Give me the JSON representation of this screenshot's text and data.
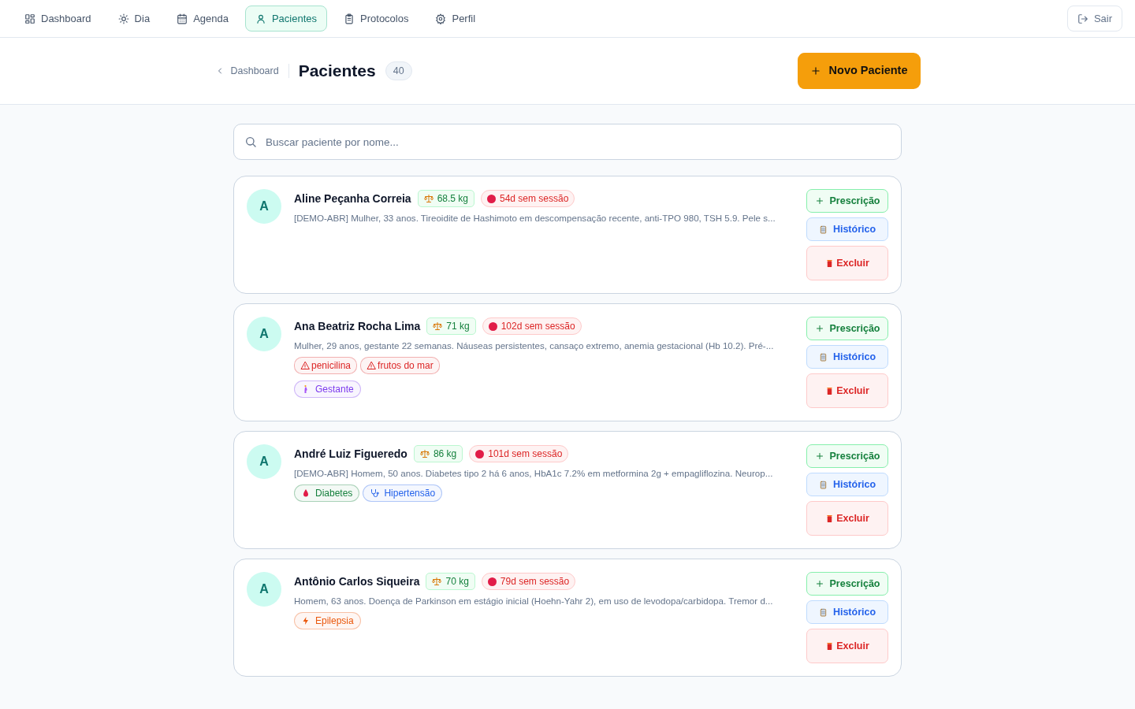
{
  "nav": {
    "items": [
      {
        "label": "Dashboard",
        "kind": "grid",
        "selected": false
      },
      {
        "label": "Dia",
        "kind": "sun",
        "selected": false
      },
      {
        "label": "Agenda",
        "kind": "calendar",
        "selected": false
      },
      {
        "label": "Pacientes",
        "kind": "user",
        "selected": true
      },
      {
        "label": "Protocolos",
        "kind": "clipboard",
        "selected": false
      },
      {
        "label": "Perfil",
        "kind": "gear",
        "selected": false
      }
    ],
    "logout": "Sair"
  },
  "header": {
    "breadcrumb": "Dashboard",
    "title": "Pacientes",
    "count": "40",
    "new_button": "Novo Paciente"
  },
  "search": {
    "placeholder": "Buscar paciente por nome..."
  },
  "patients": [
    {
      "initial": "A",
      "name": "Aline Peçanha Correia",
      "weight": "68.5 kg",
      "session": "54d sem sessão",
      "description": "[DEMO-ABR] Mulher, 33 anos. Tireoidite de Hashimoto em descompensação recente, anti-TPO 980, TSH 5.9. Pele s...",
      "actions": [
        {
          "label": "Prescrição",
          "kind": "prescribe"
        },
        {
          "label": "Histórico",
          "kind": "history"
        },
        {
          "label": "Excluir",
          "kind": "delete"
        }
      ]
    },
    {
      "initial": "A",
      "name": "Ana Beatriz Rocha Lima",
      "weight": "71 kg",
      "session": "102d sem sessão",
      "description": "Mulher, 29 anos, gestante 22 semanas. Náuseas persistentes, cansaço extremo, anemia gestacional (Hb 10.2). Pré-...",
      "tag_rows": [
        [
          {
            "label": "penicilina",
            "kind": "allergy",
            "color": "#dc2626"
          },
          {
            "label": "frutos do mar",
            "kind": "allergy",
            "color": "#dc2626"
          }
        ],
        [
          {
            "label": "Gestante",
            "kind": "pregnancy",
            "color": "#7c3aed"
          }
        ]
      ],
      "actions": [
        {
          "label": "Prescrição",
          "kind": "prescribe"
        },
        {
          "label": "Histórico",
          "kind": "history"
        },
        {
          "label": "Excluir",
          "kind": "delete"
        }
      ]
    },
    {
      "initial": "A",
      "name": "André Luiz Figueredo",
      "weight": "86 kg",
      "session": "101d sem sessão",
      "description": "[DEMO-ABR] Homem, 50 anos. Diabetes tipo 2 há 6 anos, HbA1c 7.2% em metformina 2g + empagliflozina. Neurop...",
      "tag_rows": [
        [
          {
            "label": "Diabetes",
            "kind": "diabetes",
            "color": "#15803d"
          },
          {
            "label": "Hipertensão",
            "kind": "hypertension",
            "color": "#2563eb"
          }
        ]
      ],
      "actions": [
        {
          "label": "Prescrição",
          "kind": "prescribe"
        },
        {
          "label": "Histórico",
          "kind": "history"
        },
        {
          "label": "Excluir",
          "kind": "delete"
        }
      ]
    },
    {
      "initial": "A",
      "name": "Antônio Carlos Siqueira",
      "weight": "70 kg",
      "session": "79d sem sessão",
      "description": "Homem, 63 anos. Doença de Parkinson em estágio inicial (Hoehn-Yahr 2), em uso de levodopa/carbidopa. Tremor d...",
      "tag_rows": [
        [
          {
            "label": "Epilepsia",
            "kind": "epilepsy",
            "color": "#ea580c"
          }
        ]
      ],
      "actions": [
        {
          "label": "Prescrição",
          "kind": "prescribe"
        },
        {
          "label": "Histórico",
          "kind": "history"
        },
        {
          "label": "Excluir",
          "kind": "delete"
        }
      ]
    }
  ]
}
